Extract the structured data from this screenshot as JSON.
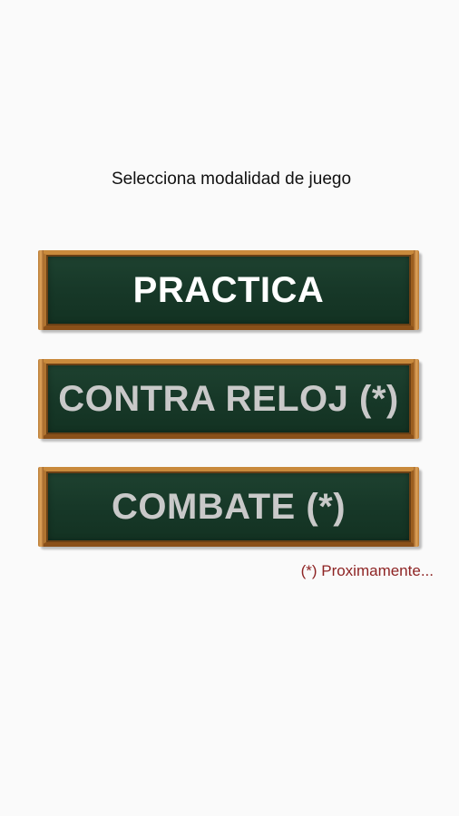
{
  "screen": {
    "title": "Selecciona modalidad de juego"
  },
  "modes": [
    {
      "label": "PRACTICA",
      "available": true
    },
    {
      "label": "CONTRA RELOJ (*)",
      "available": false
    },
    {
      "label": "COMBATE (*)",
      "available": false
    }
  ],
  "footnote": "(*) Proximamente...",
  "colors": {
    "board_green": "#173828",
    "wood_frame": "#c98a3c",
    "active_text": "#ffffff",
    "disabled_text": "#c9c9c9",
    "footnote_text": "#8e2424",
    "background": "#fafafa"
  }
}
